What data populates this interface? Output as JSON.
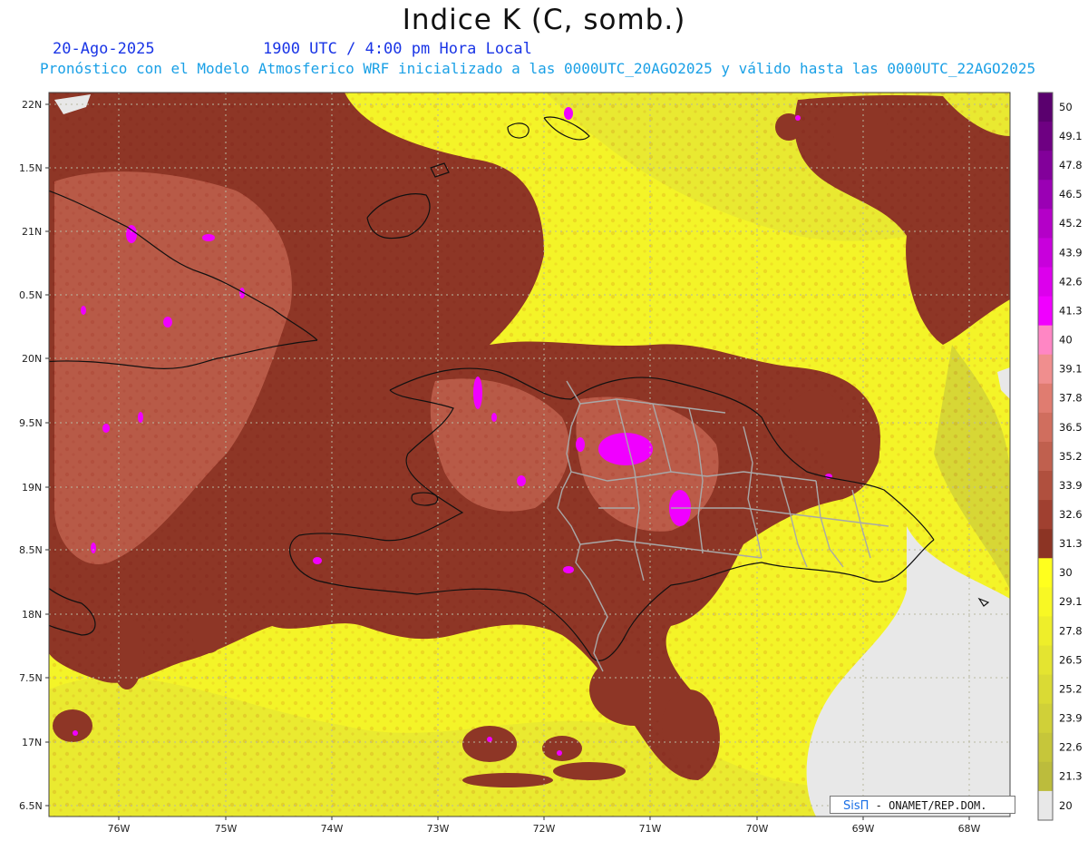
{
  "header": {
    "title": "Indice K (C, somb.)",
    "date": "20-Ago-2025",
    "time": "1900 UTC / 4:00 pm Hora Local",
    "forecast": "Pronóstico con el Modelo Atmosferico WRF inicializado a las 0000UTC_20AGO2025 y válido hasta las  0000UTC_22AGO2025"
  },
  "axes": {
    "lat_labels": [
      "22N",
      "1.5N",
      "21N",
      "0.5N",
      "20N",
      "9.5N",
      "19N",
      "8.5N",
      "18N",
      "7.5N",
      "17N",
      "6.5N"
    ],
    "lon_labels": [
      "76W",
      "75W",
      "74W",
      "73W",
      "72W",
      "71W",
      "70W",
      "69W",
      "68W"
    ]
  },
  "colorbar": {
    "labels": [
      "50",
      "49.1",
      "47.8",
      "46.5",
      "45.2",
      "43.9",
      "42.6",
      "41.3",
      "40",
      "39.1",
      "37.8",
      "36.5",
      "35.2",
      "33.9",
      "32.6",
      "31.3",
      "30",
      "29.1",
      "27.8",
      "26.5",
      "25.2",
      "23.9",
      "22.6",
      "21.3",
      "20"
    ],
    "colors": [
      "#5a006e",
      "#6e0082",
      "#82009a",
      "#9a00b4",
      "#b400c8",
      "#c800dc",
      "#dc00ec",
      "#f000ff",
      "#ff86c4",
      "#f08e8e",
      "#e07c70",
      "#d06e5e",
      "#c0604e",
      "#b0503e",
      "#a04030",
      "#8c3424",
      "#ffff1e",
      "#f8f824",
      "#eeee2a",
      "#e4e430",
      "#dada34",
      "#d0d038",
      "#c6c63a",
      "#bcbc3c",
      "#e8e8e8"
    ]
  },
  "credit": {
    "brand": "SisΠ",
    "text": "- ONAMET/REP.DOM."
  }
}
